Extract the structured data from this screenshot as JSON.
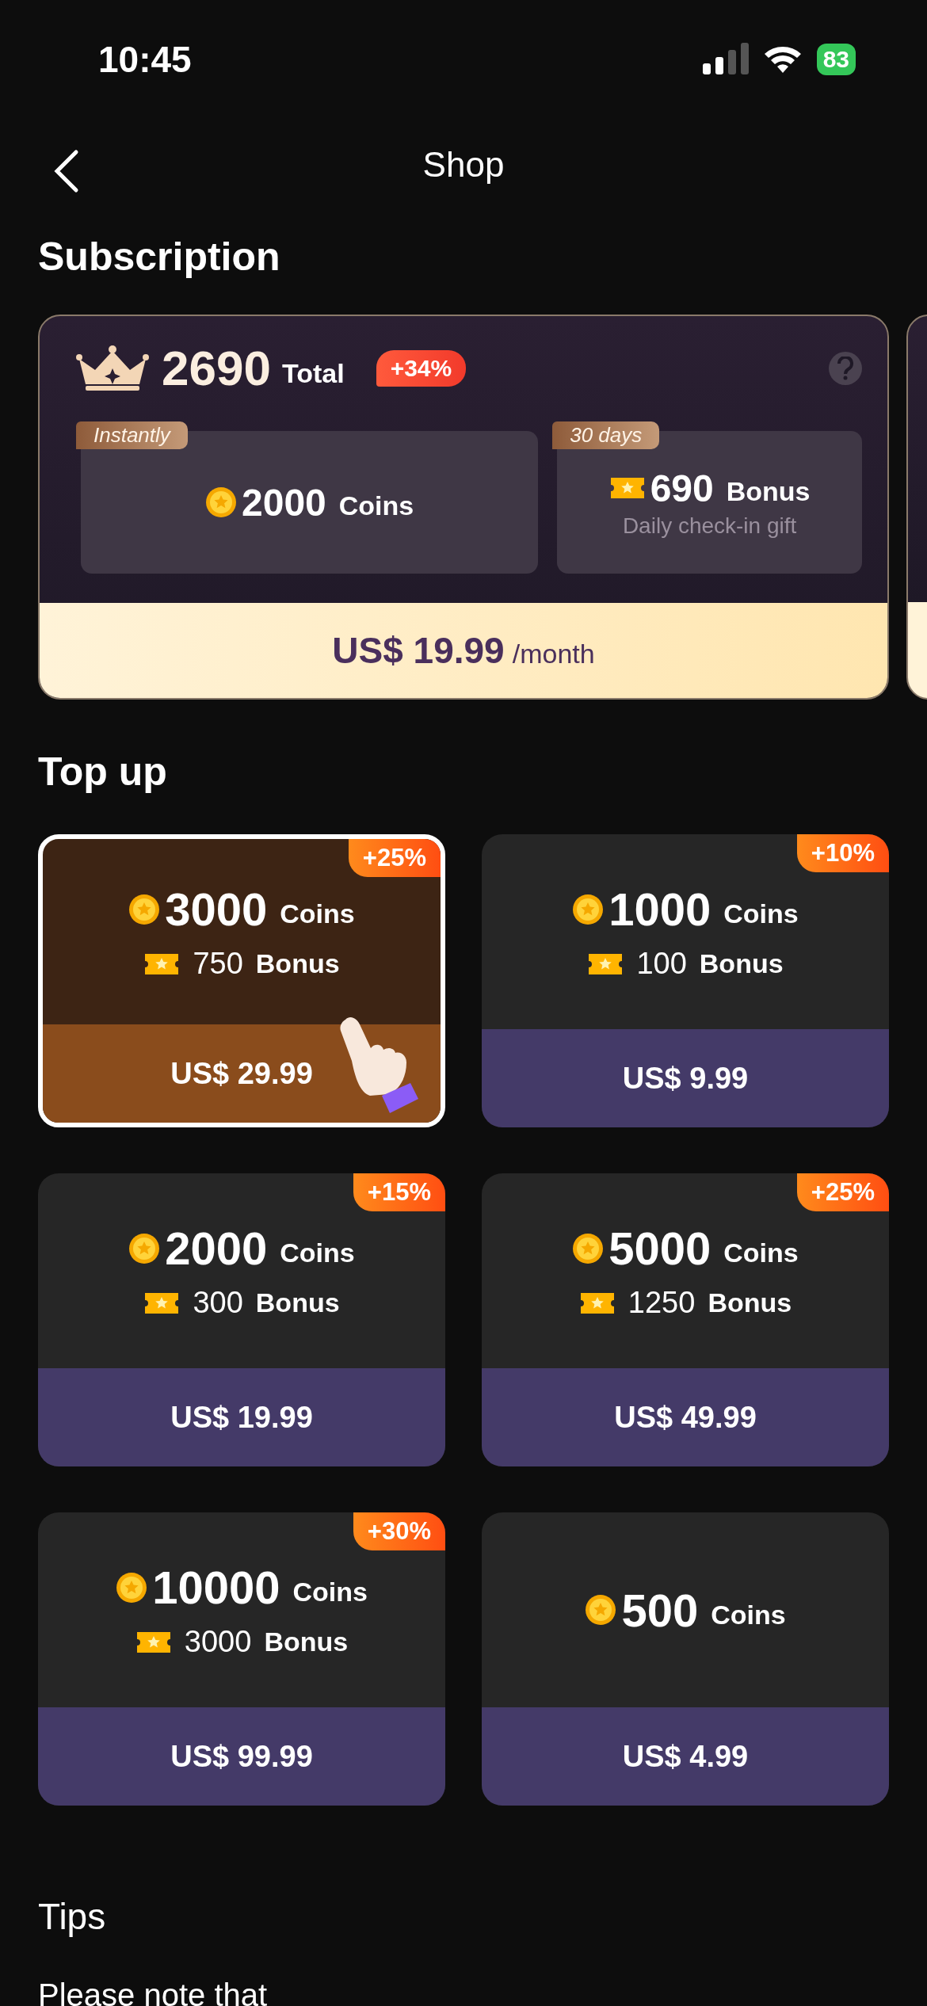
{
  "status_bar": {
    "time": "10:45",
    "battery": "83"
  },
  "nav": {
    "title": "Shop"
  },
  "subscription": {
    "heading": "Subscription",
    "total": "2690",
    "total_label": "Total",
    "badge": "+34%",
    "blocks": [
      {
        "kind": "coins",
        "tag": "Instantly",
        "amount": "2000",
        "unit": "Coins"
      },
      {
        "kind": "bonus",
        "tag": "30 days",
        "amount": "690",
        "unit": "Bonus",
        "note": "Daily check-in gift"
      }
    ],
    "price": "US$ 19.99",
    "period": "/month"
  },
  "top_up": {
    "heading": "Top up",
    "packages": [
      {
        "selected": true,
        "badge": "+25%",
        "coins": "3000",
        "coins_unit": "Coins",
        "bonus": "750",
        "bonus_unit": "Bonus",
        "price": "US$ 29.99"
      },
      {
        "selected": false,
        "badge": "+10%",
        "coins": "1000",
        "coins_unit": "Coins",
        "bonus": "100",
        "bonus_unit": "Bonus",
        "price": "US$ 9.99"
      },
      {
        "selected": false,
        "badge": "+15%",
        "coins": "2000",
        "coins_unit": "Coins",
        "bonus": "300",
        "bonus_unit": "Bonus",
        "price": "US$ 19.99"
      },
      {
        "selected": false,
        "badge": "+25%",
        "coins": "5000",
        "coins_unit": "Coins",
        "bonus": "1250",
        "bonus_unit": "Bonus",
        "price": "US$ 49.99"
      },
      {
        "selected": false,
        "badge": "+30%",
        "coins": "10000",
        "coins_unit": "Coins",
        "bonus": "3000",
        "bonus_unit": "Bonus",
        "price": "US$ 99.99"
      },
      {
        "selected": false,
        "coins": "500",
        "coins_unit": "Coins",
        "price": "US$ 4.99"
      }
    ]
  },
  "tips": {
    "heading": "Tips",
    "text": "Please note that"
  }
}
